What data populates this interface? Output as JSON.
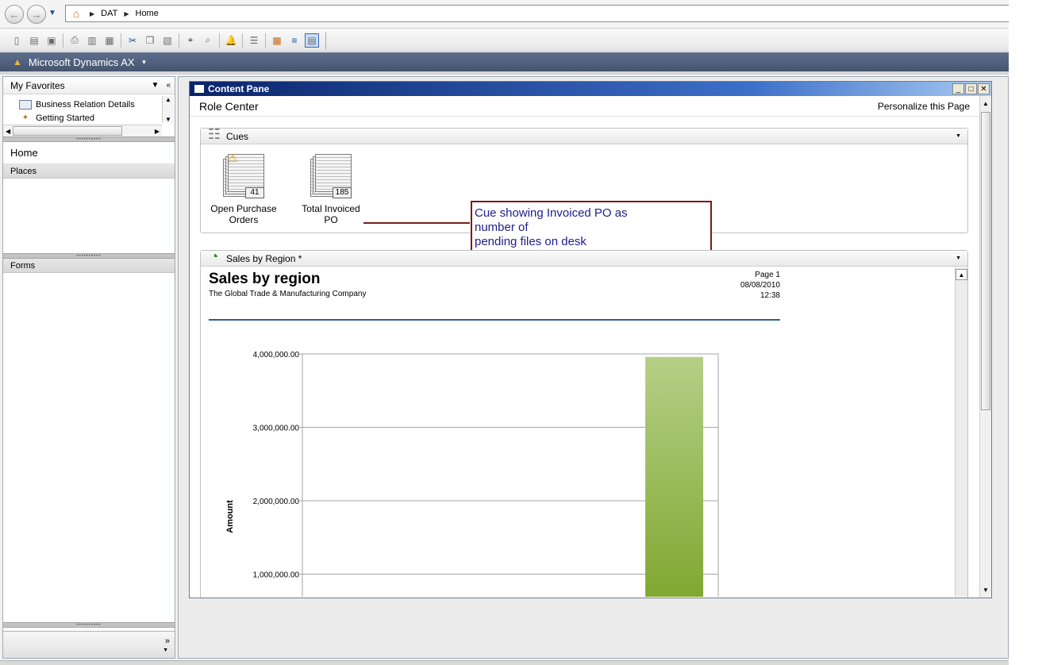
{
  "address": {
    "crumbs": [
      "DAT",
      "Home"
    ]
  },
  "app_band": {
    "title": "Microsoft Dynamics AX"
  },
  "nav": {
    "favorites_title": "My Favorites",
    "favorites": [
      {
        "label": "Business Relation Details"
      },
      {
        "label": "Getting Started"
      }
    ],
    "home": "Home",
    "places": "Places",
    "forms": "Forms"
  },
  "content": {
    "window_title": "Content Pane",
    "role_center": "Role Center",
    "personalize": "Personalize this Page",
    "cues_title": "Cues",
    "cues": [
      {
        "label": "Open Purchase Orders",
        "count": "41"
      },
      {
        "label": "Total Invoiced PO",
        "count": "185"
      }
    ],
    "callout": [
      "Cue showing Invoiced PO as",
      "number of",
      "pending files on desk"
    ],
    "sales_part_title": "Sales by Region *"
  },
  "report": {
    "title": "Sales by region",
    "company": "The Global Trade & Manufacturing Company",
    "page": "Page 1",
    "date": "08/08/2010",
    "time": "12:38"
  },
  "chart_data": {
    "type": "bar",
    "title": "",
    "xlabel": "",
    "ylabel": "Amount",
    "ylim": [
      1000000,
      4000000
    ],
    "ytick_values": [
      1000000,
      2000000,
      3000000,
      4000000
    ],
    "yticks": [
      "1,000,000.00",
      "2,000,000.00",
      "3,000,000.00",
      "4,000,000.00"
    ],
    "grid": true,
    "categories": [
      "",
      "",
      "",
      "",
      ""
    ],
    "values": [
      null,
      null,
      null,
      null,
      3960000
    ],
    "bar_color_top": "#b6cf87",
    "bar_color_bottom": "#7ea62e"
  }
}
